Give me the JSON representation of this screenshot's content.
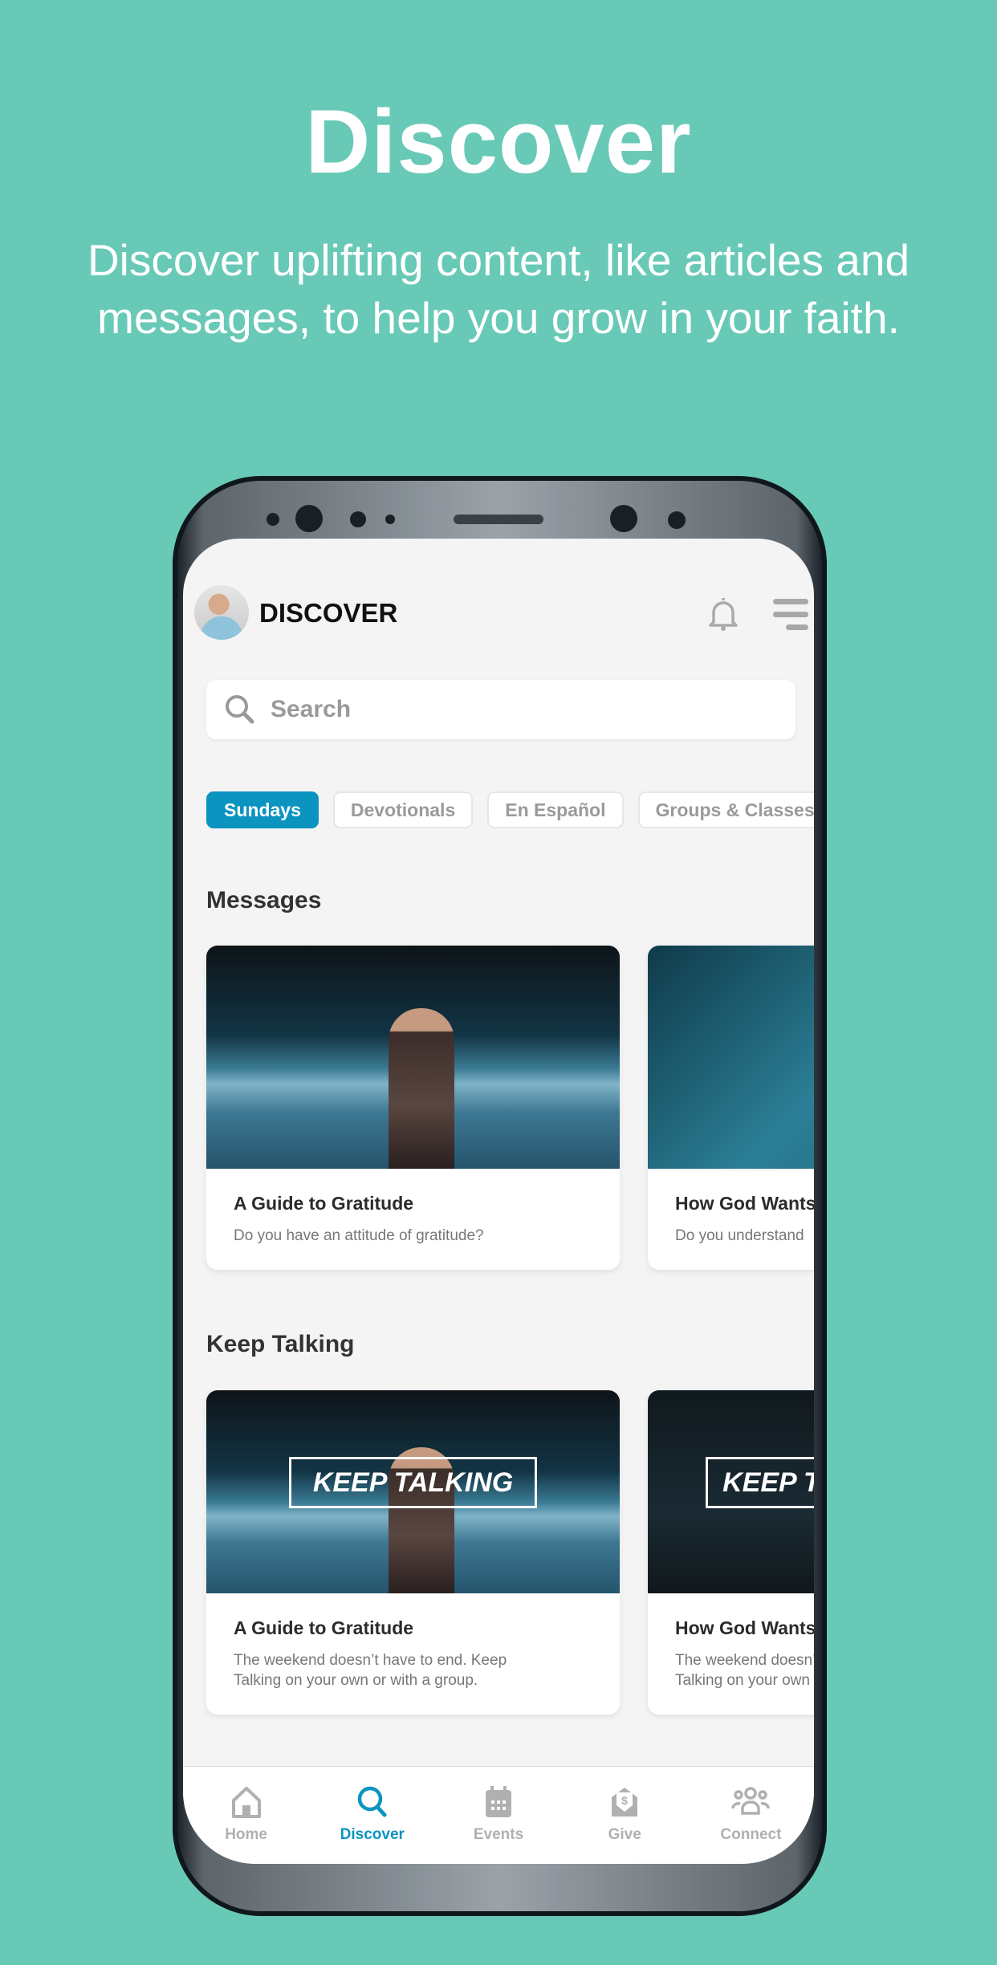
{
  "hero": {
    "title": "Discover",
    "subtitle": "Discover uplifting content, like articles and messages, to help you grow in your faith."
  },
  "app": {
    "header": {
      "title": "DISCOVER",
      "icons": [
        "avatar",
        "bell-icon",
        "menu-icon"
      ]
    },
    "search": {
      "placeholder": "Search"
    },
    "chips": [
      {
        "label": "Sundays",
        "active": true
      },
      {
        "label": "Devotionals"
      },
      {
        "label": "En Español"
      },
      {
        "label": "Groups & Classes"
      }
    ],
    "sections": [
      {
        "title": "Messages",
        "cards": [
          {
            "title": "A Guide to Gratitude",
            "desc": "Do you have an attitude of gratitude?"
          },
          {
            "title": "How God Wants",
            "desc": "Do you understand"
          }
        ]
      },
      {
        "title": "Keep Talking",
        "overlay": "KEEP TALKING",
        "cards": [
          {
            "title": "A Guide to Gratitude",
            "desc": "The weekend doesn’t have to end. Keep Talking on your own or with a group."
          },
          {
            "title": "How God Wants",
            "desc": "The weekend doesn’t have to end. Keep Talking on your own or with a group."
          }
        ]
      }
    ],
    "tabs": [
      {
        "label": "Home",
        "icon": "home-icon"
      },
      {
        "label": "Discover",
        "icon": "search-icon",
        "active": true
      },
      {
        "label": "Events",
        "icon": "calendar-icon"
      },
      {
        "label": "Give",
        "icon": "give-icon"
      },
      {
        "label": "Connect",
        "icon": "people-icon"
      }
    ],
    "accent": "#0b94c0"
  }
}
